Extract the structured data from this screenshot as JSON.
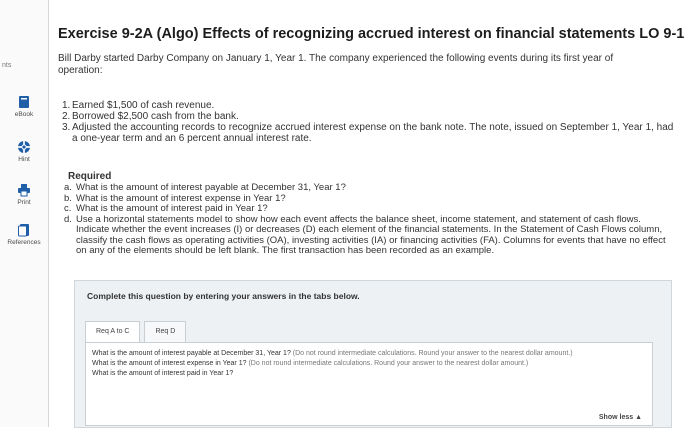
{
  "sidebar": {
    "points_label": "nts",
    "tools": [
      {
        "label": "eBook",
        "icon": "book-icon"
      },
      {
        "label": "Hint",
        "icon": "life-ring-icon"
      },
      {
        "label": "Print",
        "icon": "printer-icon"
      },
      {
        "label": "References",
        "icon": "document-icon"
      }
    ]
  },
  "title": "Exercise 9-2A (Algo) Effects of recognizing accrued interest on financial statements LO 9-1",
  "intro": "Bill Darby started Darby Company on January 1, Year 1. The company experienced the following events during its first year of operation:",
  "events": [
    {
      "num": "1.",
      "text": "Earned $1,500 of cash revenue."
    },
    {
      "num": "2.",
      "text": "Borrowed $2,500 cash from the bank."
    },
    {
      "num": "3.",
      "text": "Adjusted the accounting records to recognize accrued interest expense on the bank note. The note, issued on September 1, Year 1, had a one-year term and an 6 percent annual interest rate."
    }
  ],
  "required_heading": "Required",
  "requirements": [
    {
      "letter": "a.",
      "text": "What is the amount of interest payable at December 31, Year 1?"
    },
    {
      "letter": "b.",
      "text": "What is the amount of interest expense in Year 1?"
    },
    {
      "letter": "c.",
      "text": "What is the amount of interest paid in Year 1?"
    },
    {
      "letter": "d.",
      "text": "Use a horizontal statements model to show how each event affects the balance sheet, income statement, and statement of cash flows. Indicate whether the event increases (I) or decreases (D) each element of the financial statements. In the Statement of Cash Flows column, classify the cash flows as operating activities (OA), investing activities (IA) or financing activities (FA). Columns for events that have no effect on any of the elements should be left blank. The first transaction has been recorded as an example."
    }
  ],
  "panel": {
    "instruction": "Complete this question by entering your answers in the tabs below.",
    "tabs": [
      {
        "label": "Req A to C",
        "active": true
      },
      {
        "label": "Req D",
        "active": false
      }
    ],
    "questions": [
      {
        "text": "What is the amount of interest payable at December 31, Year 1?",
        "note": "(Do not round intermediate calculations. Round your answer to the nearest dollar amount.)"
      },
      {
        "text": "What is the amount of interest expense in Year 1?",
        "note": "(Do not round intermediate calculations. Round your answer to the nearest dollar amount.)"
      },
      {
        "text": "What is the amount of interest paid in Year 1?",
        "note": ""
      }
    ],
    "show_less": "Show less ▲"
  }
}
